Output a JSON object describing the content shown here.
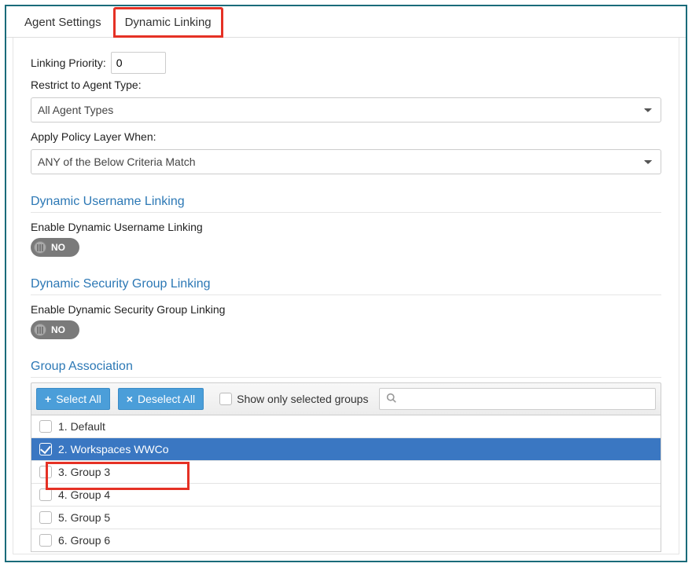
{
  "tabs": {
    "agent_settings": "Agent Settings",
    "dynamic_linking": "Dynamic Linking"
  },
  "fields": {
    "linking_priority_label": "Linking Priority:",
    "linking_priority_value": "0",
    "restrict_label": "Restrict to Agent Type:",
    "restrict_value": "All Agent Types",
    "apply_label": "Apply Policy Layer When:",
    "apply_value": "ANY of the Below Criteria Match"
  },
  "sections": {
    "dyn_user_title": "Dynamic Username Linking",
    "dyn_user_enable": "Enable Dynamic Username Linking",
    "dyn_user_state": "NO",
    "dyn_group_title": "Dynamic Security Group Linking",
    "dyn_group_enable": "Enable Dynamic Security Group Linking",
    "dyn_group_state": "NO",
    "group_assoc_title": "Group Association"
  },
  "toolbar": {
    "select_all": "Select All",
    "deselect_all": "Deselect All",
    "show_only": "Show only selected groups",
    "search_placeholder": ""
  },
  "groups": [
    {
      "label": "1. Default",
      "selected": false
    },
    {
      "label": "2. Workspaces WWCo",
      "selected": true
    },
    {
      "label": "3. Group 3",
      "selected": false
    },
    {
      "label": "4. Group 4",
      "selected": false
    },
    {
      "label": "5. Group 5",
      "selected": false
    },
    {
      "label": "6. Group 6",
      "selected": false
    }
  ]
}
